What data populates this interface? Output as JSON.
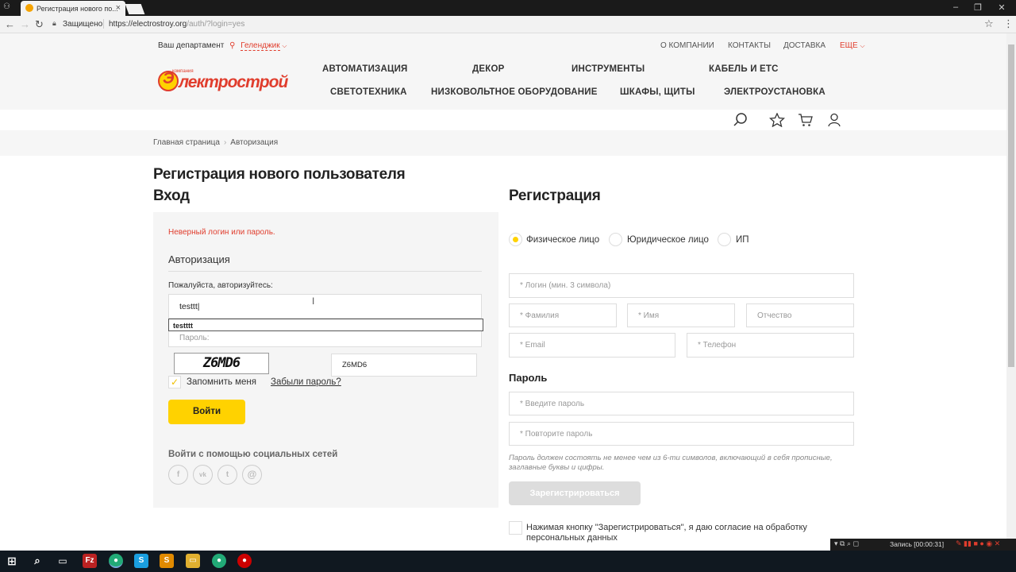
{
  "browser": {
    "tab_title": "Регистрация нового по...",
    "secure_label": "Защищено",
    "url_host": "https://electrostroy.org",
    "url_path": "/auth/?login=yes"
  },
  "header": {
    "dept_label": "Ваш департамент",
    "dept_city": "Геленджик",
    "top_links": [
      "О КОМПАНИИ",
      "КОНТАКТЫ",
      "ДОСТАВКА",
      "ЕЩЕ"
    ],
    "logo_small": "компания",
    "logo_text": "лектрострой",
    "menu_row1": [
      "АВТОМАТИЗАЦИЯ",
      "ДЕКОР",
      "ИНСТРУМЕНТЫ",
      "КАБЕЛЬ И ЕТС"
    ],
    "menu_row2": [
      "СВЕТОТЕХНИКА",
      "НИЗКОВОЛЬТНОЕ ОБОРУДОВАНИЕ",
      "ШКАФЫ, ЩИТЫ",
      "ЭЛЕКТРОУСТАНОВКА"
    ]
  },
  "breadcrumb": [
    "Главная страница",
    "Авторизация"
  ],
  "page": {
    "title": "Регистрация нового пользователя",
    "login_title": "Вход",
    "register_title": "Регистрация"
  },
  "login": {
    "error": "Неверный логин или пароль.",
    "auth_title": "Авторизация",
    "hint": "Пожалуйста, авторизуйтесь:",
    "login_value": "testtt",
    "autocomplete": "testttt",
    "password_placeholder": "Пароль:",
    "captcha_image_text": "Z6MD6",
    "captcha_value": "Z6MD6",
    "remember_label": "Запомнить меня",
    "remember_checked": true,
    "forgot_label": "Забыли пароль?",
    "submit_label": "Войти",
    "social_title": "Войти с помощью социальных сетей",
    "social": [
      "f",
      "vk",
      "t",
      "@"
    ]
  },
  "register": {
    "person_types": [
      {
        "label": "Физическое лицо",
        "selected": true
      },
      {
        "label": "Юридическое лицо",
        "selected": false
      },
      {
        "label": "ИП",
        "selected": false
      }
    ],
    "login_placeholder": "* Логин (мин. 3 символа)",
    "lastname_placeholder": "* Фамилия",
    "firstname_placeholder": "* Имя",
    "middlename_placeholder": "Отчество",
    "email_placeholder": "* Email",
    "phone_placeholder": "* Телефон",
    "password_heading": "Пароль",
    "password_placeholder": "* Введите пароль",
    "password_repeat_placeholder": "* Повторите пароль",
    "password_note": "Пароль должен состоять не менее чем из 6-ти символов, включающий в себя прописные, заглавные буквы и цифры.",
    "submit_label": "Зарегистрироваться",
    "consent": "Нажимая кнопку \"Зарегистрироваться\", я даю согласие на обработку персональных данных"
  },
  "recorder": {
    "label": "Запись [00:00:31]"
  },
  "colors": {
    "accent": "#ffd200",
    "brand_red": "#e03d2d"
  }
}
